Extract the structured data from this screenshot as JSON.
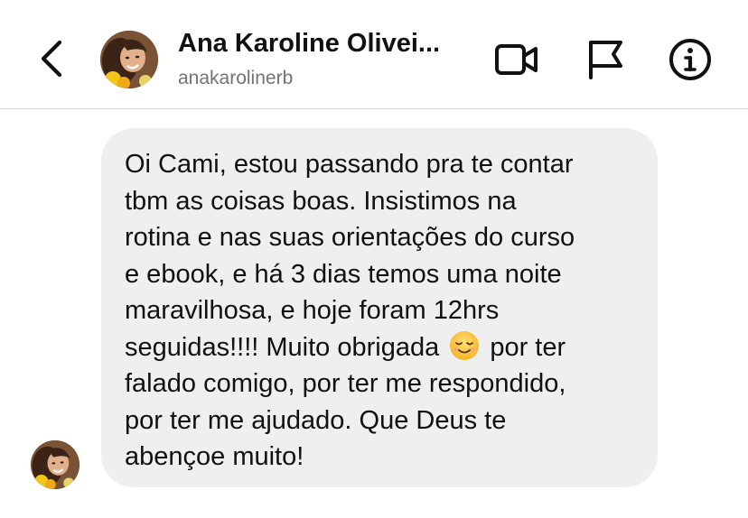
{
  "header": {
    "contact_name": "Ana Karoline Olivei...",
    "contact_handle": "anakarolinerb",
    "icons": {
      "back": "chevron-left-icon",
      "video": "video-camera-icon",
      "report": "flag-icon",
      "info": "info-icon"
    }
  },
  "message": {
    "text_before_emoji": "Oi Cami, estou passando pra te contar\ntbm as coisas boas. Insistimos na\nrotina e nas suas orientações do curso\ne ebook, e há 3 dias temos uma noite\nmaravilhosa, e hoje foram 12hrs\nseguidas!!!! Muito obrigada ",
    "emoji": "smiling-face-icon",
    "text_after_emoji": " por ter\nfalado comigo, por ter me respondido,\npor ter me ajudado. Que Deus te\nabençoe muito!"
  },
  "colors": {
    "bubble_bg": "#efefef",
    "handle_text": "#737373",
    "divider": "#dbdbdb",
    "text": "#111111"
  }
}
